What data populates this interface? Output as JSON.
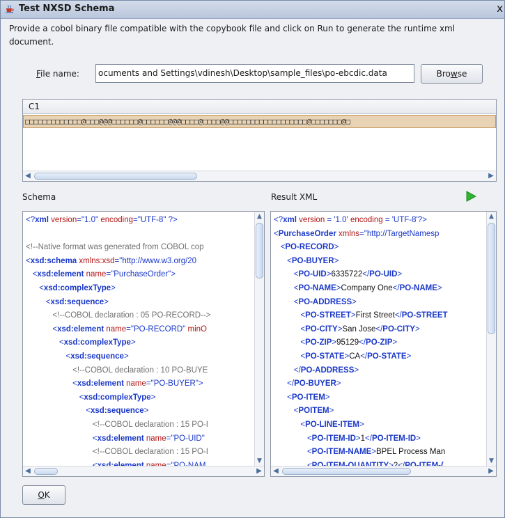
{
  "window": {
    "title": "Test NXSD Schema",
    "close_label": "x"
  },
  "instructions": "Provide a cobol binary file compatible with the copybook file and click on Run to generate the runtime xml document.",
  "file": {
    "label_prefix": "",
    "label_underlined": "F",
    "label_rest": "ile name:",
    "value": "ocuments and Settings\\vdinesh\\Desktop\\sample_files\\po-ebcdic.data",
    "browse_pre": "Bro",
    "browse_underlined": "w",
    "browse_post": "se"
  },
  "grid": {
    "column_header": "C1",
    "row_value": "□□□□□□□□□□□□□@□□□@@@□□□□□□@□□□□□□@@@□□□□@□□□□@@□□□□□□□□□□□□□□□□□□@□□□□□□□@□"
  },
  "schema_panel": {
    "label": "Schema",
    "lines": [
      [
        [
          "pun",
          "<?"
        ],
        [
          "tag",
          "xml"
        ],
        [
          "txt",
          " "
        ],
        [
          "attr",
          "version"
        ],
        [
          "pun",
          "="
        ],
        [
          "aval",
          "\"1.0\""
        ],
        [
          "txt",
          " "
        ],
        [
          "attr",
          "encoding"
        ],
        [
          "pun",
          "="
        ],
        [
          "aval",
          "\"UTF-8\""
        ],
        [
          "pun",
          " ?>"
        ]
      ],
      [
        [
          "txt",
          " "
        ]
      ],
      [
        [
          "cmt",
          "<!--Native format was generated from COBOL cop"
        ]
      ],
      [
        [
          "pun",
          "<"
        ],
        [
          "tag",
          "xsd:schema"
        ],
        [
          "txt",
          " "
        ],
        [
          "attr",
          "xmlns:xsd"
        ],
        [
          "pun",
          "="
        ],
        [
          "aval",
          "\"http://www.w3.org/20"
        ]
      ],
      [
        [
          "txt",
          "   "
        ],
        [
          "pun",
          "<"
        ],
        [
          "tag",
          "xsd:element"
        ],
        [
          "txt",
          " "
        ],
        [
          "attr",
          "name"
        ],
        [
          "pun",
          "="
        ],
        [
          "aval",
          "\"PurchaseOrder\""
        ],
        [
          "pun",
          ">"
        ]
      ],
      [
        [
          "txt",
          "      "
        ],
        [
          "pun",
          "<"
        ],
        [
          "tag",
          "xsd:complexType"
        ],
        [
          "pun",
          ">"
        ]
      ],
      [
        [
          "txt",
          "         "
        ],
        [
          "pun",
          "<"
        ],
        [
          "tag",
          "xsd:sequence"
        ],
        [
          "pun",
          ">"
        ]
      ],
      [
        [
          "txt",
          "            "
        ],
        [
          "cmt",
          "<!--COBOL declaration : 05 PO-RECORD-->"
        ]
      ],
      [
        [
          "txt",
          "            "
        ],
        [
          "pun",
          "<"
        ],
        [
          "tag",
          "xsd:element"
        ],
        [
          "txt",
          " "
        ],
        [
          "attr",
          "name"
        ],
        [
          "pun",
          "="
        ],
        [
          "aval",
          "\"PO-RECORD\""
        ],
        [
          "txt",
          " "
        ],
        [
          "attr",
          "minO"
        ]
      ],
      [
        [
          "txt",
          "               "
        ],
        [
          "pun",
          "<"
        ],
        [
          "tag",
          "xsd:complexType"
        ],
        [
          "pun",
          ">"
        ]
      ],
      [
        [
          "txt",
          "                  "
        ],
        [
          "pun",
          "<"
        ],
        [
          "tag",
          "xsd:sequence"
        ],
        [
          "pun",
          ">"
        ]
      ],
      [
        [
          "txt",
          "                     "
        ],
        [
          "cmt",
          "<!--COBOL declaration : 10 PO-BUYE"
        ]
      ],
      [
        [
          "txt",
          "                     "
        ],
        [
          "pun",
          "<"
        ],
        [
          "tag",
          "xsd:element"
        ],
        [
          "txt",
          " "
        ],
        [
          "attr",
          "name"
        ],
        [
          "pun",
          "="
        ],
        [
          "aval",
          "\"PO-BUYER\""
        ],
        [
          "pun",
          ">"
        ]
      ],
      [
        [
          "txt",
          "                        "
        ],
        [
          "pun",
          "<"
        ],
        [
          "tag",
          "xsd:complexType"
        ],
        [
          "pun",
          ">"
        ]
      ],
      [
        [
          "txt",
          "                           "
        ],
        [
          "pun",
          "<"
        ],
        [
          "tag",
          "xsd:sequence"
        ],
        [
          "pun",
          ">"
        ]
      ],
      [
        [
          "txt",
          "                              "
        ],
        [
          "cmt",
          "<!--COBOL declaration : 15 PO-I"
        ]
      ],
      [
        [
          "txt",
          "                              "
        ],
        [
          "pun",
          "<"
        ],
        [
          "tag",
          "xsd:element"
        ],
        [
          "txt",
          " "
        ],
        [
          "attr",
          "name"
        ],
        [
          "pun",
          "="
        ],
        [
          "aval",
          "\"PO-UID\""
        ]
      ],
      [
        [
          "txt",
          "                              "
        ],
        [
          "cmt",
          "<!--COBOL declaration : 15 PO-I"
        ]
      ],
      [
        [
          "txt",
          "                              "
        ],
        [
          "pun",
          "<"
        ],
        [
          "tag",
          "xsd:element"
        ],
        [
          "txt",
          " "
        ],
        [
          "attr",
          "name"
        ],
        [
          "pun",
          "="
        ],
        [
          "aval",
          "\"PO-NAM"
        ]
      ]
    ]
  },
  "result_panel": {
    "label": "Result XML",
    "lines": [
      [
        [
          "pun",
          "<?"
        ],
        [
          "tag",
          "xml"
        ],
        [
          "txt",
          " "
        ],
        [
          "attr",
          "version"
        ],
        [
          "pun",
          " = "
        ],
        [
          "aval",
          "'1.0'"
        ],
        [
          "txt",
          " "
        ],
        [
          "attr",
          "encoding"
        ],
        [
          "pun",
          " = "
        ],
        [
          "aval",
          "'UTF-8'"
        ],
        [
          "pun",
          "?>"
        ]
      ],
      [
        [
          "pun",
          "<"
        ],
        [
          "tag",
          "PurchaseOrder"
        ],
        [
          "txt",
          " "
        ],
        [
          "attr",
          "xmlns"
        ],
        [
          "pun",
          "="
        ],
        [
          "aval",
          "\"http://TargetNamesp"
        ]
      ],
      [
        [
          "txt",
          "   "
        ],
        [
          "pun",
          "<"
        ],
        [
          "tag",
          "PO-RECORD"
        ],
        [
          "pun",
          ">"
        ]
      ],
      [
        [
          "txt",
          "      "
        ],
        [
          "pun",
          "<"
        ],
        [
          "tag",
          "PO-BUYER"
        ],
        [
          "pun",
          ">"
        ]
      ],
      [
        [
          "txt",
          "         "
        ],
        [
          "pun",
          "<"
        ],
        [
          "tag",
          "PO-UID"
        ],
        [
          "pun",
          ">"
        ],
        [
          "txt",
          "6335722"
        ],
        [
          "pun",
          "</"
        ],
        [
          "tag",
          "PO-UID"
        ],
        [
          "pun",
          ">"
        ]
      ],
      [
        [
          "txt",
          "         "
        ],
        [
          "pun",
          "<"
        ],
        [
          "tag",
          "PO-NAME"
        ],
        [
          "pun",
          ">"
        ],
        [
          "txt",
          "Company One"
        ],
        [
          "pun",
          "</"
        ],
        [
          "tag",
          "PO-NAME"
        ],
        [
          "pun",
          ">"
        ]
      ],
      [
        [
          "txt",
          "         "
        ],
        [
          "pun",
          "<"
        ],
        [
          "tag",
          "PO-ADDRESS"
        ],
        [
          "pun",
          ">"
        ]
      ],
      [
        [
          "txt",
          "            "
        ],
        [
          "pun",
          "<"
        ],
        [
          "tag",
          "PO-STREET"
        ],
        [
          "pun",
          ">"
        ],
        [
          "txt",
          "First Street"
        ],
        [
          "pun",
          "</"
        ],
        [
          "tag",
          "PO-STREET"
        ]
      ],
      [
        [
          "txt",
          "            "
        ],
        [
          "pun",
          "<"
        ],
        [
          "tag",
          "PO-CITY"
        ],
        [
          "pun",
          ">"
        ],
        [
          "txt",
          "San Jose"
        ],
        [
          "pun",
          "</"
        ],
        [
          "tag",
          "PO-CITY"
        ],
        [
          "pun",
          ">"
        ]
      ],
      [
        [
          "txt",
          "            "
        ],
        [
          "pun",
          "<"
        ],
        [
          "tag",
          "PO-ZIP"
        ],
        [
          "pun",
          ">"
        ],
        [
          "txt",
          "95129"
        ],
        [
          "pun",
          "</"
        ],
        [
          "tag",
          "PO-ZIP"
        ],
        [
          "pun",
          ">"
        ]
      ],
      [
        [
          "txt",
          "            "
        ],
        [
          "pun",
          "<"
        ],
        [
          "tag",
          "PO-STATE"
        ],
        [
          "pun",
          ">"
        ],
        [
          "txt",
          "CA"
        ],
        [
          "pun",
          "</"
        ],
        [
          "tag",
          "PO-STATE"
        ],
        [
          "pun",
          ">"
        ]
      ],
      [
        [
          "txt",
          "         "
        ],
        [
          "pun",
          "</"
        ],
        [
          "tag",
          "PO-ADDRESS"
        ],
        [
          "pun",
          ">"
        ]
      ],
      [
        [
          "txt",
          "      "
        ],
        [
          "pun",
          "</"
        ],
        [
          "tag",
          "PO-BUYER"
        ],
        [
          "pun",
          ">"
        ]
      ],
      [
        [
          "txt",
          "      "
        ],
        [
          "pun",
          "<"
        ],
        [
          "tag",
          "PO-ITEM"
        ],
        [
          "pun",
          ">"
        ]
      ],
      [
        [
          "txt",
          "         "
        ],
        [
          "pun",
          "<"
        ],
        [
          "tag",
          "POITEM"
        ],
        [
          "pun",
          ">"
        ]
      ],
      [
        [
          "txt",
          "            "
        ],
        [
          "pun",
          "<"
        ],
        [
          "tag",
          "PO-LINE-ITEM"
        ],
        [
          "pun",
          ">"
        ]
      ],
      [
        [
          "txt",
          "               "
        ],
        [
          "pun",
          "<"
        ],
        [
          "tag",
          "PO-ITEM-ID"
        ],
        [
          "pun",
          ">"
        ],
        [
          "txt",
          "1"
        ],
        [
          "pun",
          "</"
        ],
        [
          "tag",
          "PO-ITEM-ID"
        ],
        [
          "pun",
          ">"
        ]
      ],
      [
        [
          "txt",
          "               "
        ],
        [
          "pun",
          "<"
        ],
        [
          "tag",
          "PO-ITEM-NAME"
        ],
        [
          "pun",
          ">"
        ],
        [
          "txt",
          "BPEL Process Man"
        ]
      ],
      [
        [
          "txt",
          "               "
        ],
        [
          "pun",
          "<"
        ],
        [
          "tag",
          "PO-ITEM-QUANTITY"
        ],
        [
          "pun",
          ">"
        ],
        [
          "txt",
          "2"
        ],
        [
          "pun",
          "</"
        ],
        [
          "tag",
          "PO-ITEM-("
        ]
      ]
    ]
  },
  "buttons": {
    "ok_underlined": "O",
    "ok_rest": "K"
  },
  "colors": {
    "tag": "#1a38c8",
    "attribute": "#b21414",
    "comment": "#6f6f6f",
    "selected_row": "#e8d3b4",
    "run_icon": "#2fb52f"
  },
  "icons": {
    "title": "java-cup-icon",
    "run": "run-play-icon"
  }
}
